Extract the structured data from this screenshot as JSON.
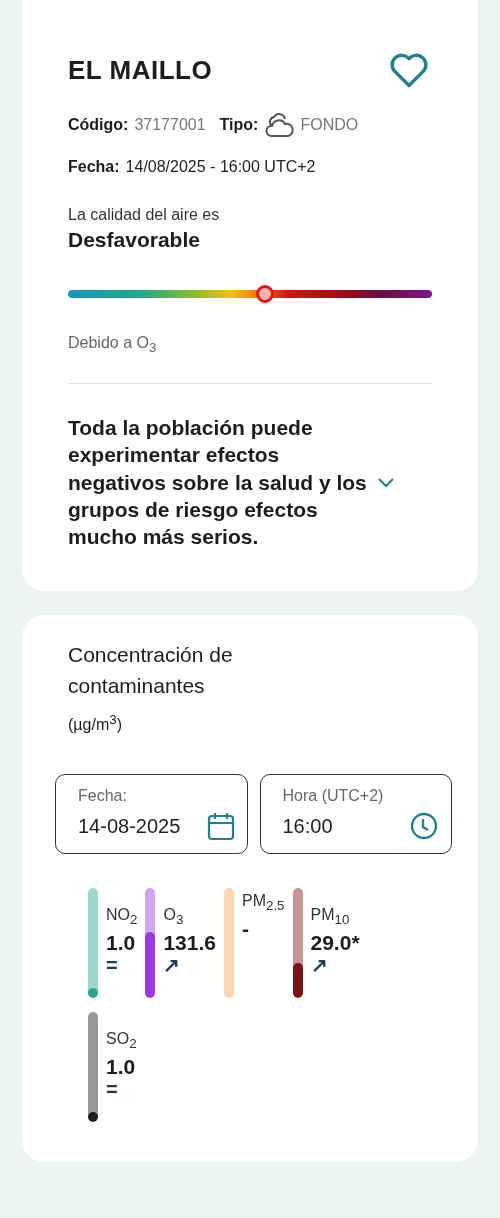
{
  "station": {
    "name": "EL MAILLO",
    "favorite": false,
    "code_label": "Código:",
    "code": "37177001",
    "type_label": "Tipo:",
    "type": "FONDO",
    "date_label": "Fecha:",
    "date": "14/08/2025 - 16:00 UTC+2",
    "quality_intro": "La calidad del aire es",
    "quality": "Desfavorable",
    "quality_level": {
      "level": 0.54
    },
    "cause": "Debido a O$_{3}$",
    "description": "Toda la población puede experimentar efectos negativos sobre la salud y los grupos de riesgo efectos mucho más serios.",
    "expanded": false
  },
  "concentration": {
    "title": "Concentración de contaminantes",
    "unit": "(µg/m$^{3}$)",
    "fields": [
      {
        "kind": "date",
        "label": "Fecha:",
        "value": "14-08-2025"
      },
      {
        "kind": "time",
        "label": "Hora (UTC+2)",
        "value": "16:00"
      }
    ],
    "pollutants": [
      {
        "name": "NO$_{2}$",
        "value": "1.0",
        "trend": "=",
        "color": "#2aa58a",
        "level": 0.04
      },
      {
        "name": "O$_{3}$",
        "value": "131.6",
        "trend": "↗",
        "color": "#9b3be0",
        "level": 0.6
      },
      {
        "name": "PM$_{2.5}$",
        "value": "-",
        "color": "#fcd6b4"
      },
      {
        "name": "PM$_{10}$",
        "value": "29.0*",
        "trend": "↗",
        "color": "#7a1414",
        "level": 0.32
      },
      {
        "name": "SO$_{2}$",
        "value": "1.0",
        "trend": "=",
        "color": "#1c1c22",
        "level": 0.04
      }
    ]
  }
}
